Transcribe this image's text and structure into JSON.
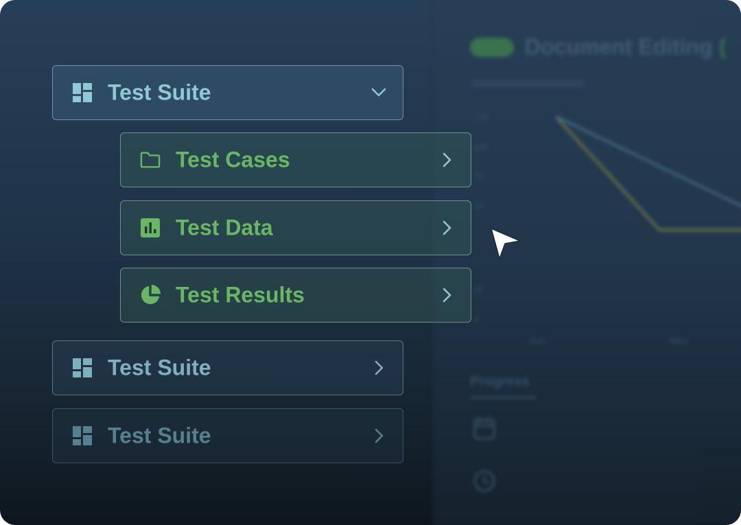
{
  "background_app": {
    "status_pill": "",
    "title": "Document Editing",
    "title_suffix": "(",
    "y_ticks": [
      "125",
      "100",
      "75",
      "50",
      "25",
      "0"
    ],
    "x_ticks": [
      "Jun",
      "May"
    ],
    "progress_heading": "Progress"
  },
  "menu": {
    "parent_open": {
      "label": "Test Suite",
      "icon": "dashboard-icon",
      "state": "expanded"
    },
    "children": [
      {
        "label": "Test Cases",
        "icon": "folder-icon"
      },
      {
        "label": "Test Data",
        "icon": "bar-chart-icon"
      },
      {
        "label": "Test Results",
        "icon": "pie-chart-icon"
      }
    ],
    "parent_collapsed": {
      "label": "Test Suite",
      "icon": "dashboard-icon",
      "state": "collapsed"
    },
    "parent_faded": {
      "label": "Test Suite",
      "icon": "dashboard-icon",
      "state": "collapsed"
    }
  },
  "colors": {
    "accent_teal": "#8fc9d3",
    "accent_green": "#69b764",
    "background": "#1f3348"
  }
}
